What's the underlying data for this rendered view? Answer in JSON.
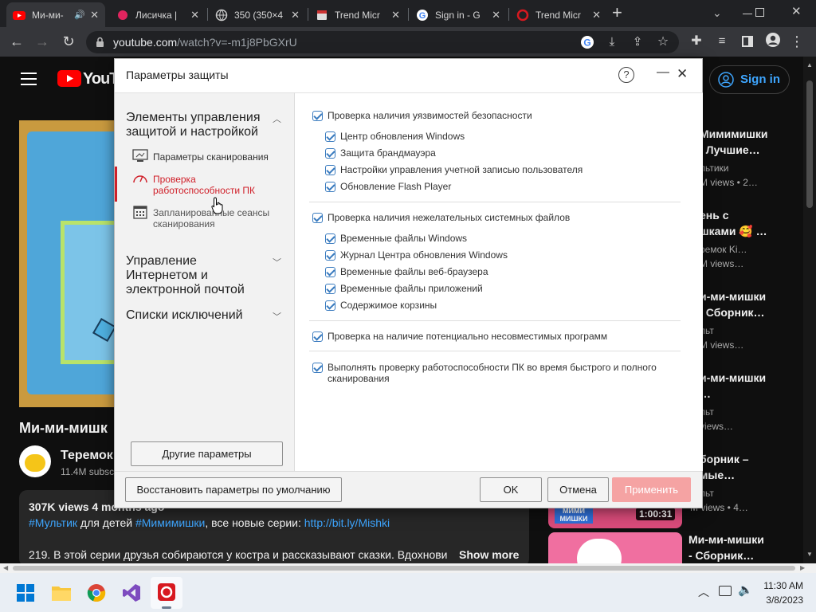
{
  "browser": {
    "tabs": [
      {
        "title": "Ми-ми-",
        "type": "youtube",
        "active": true
      },
      {
        "title": "Лисичка |",
        "type": "pink"
      },
      {
        "title": "350 (350×4",
        "type": "globe"
      },
      {
        "title": "Trend Micr",
        "type": "page"
      },
      {
        "title": "Sign in - G",
        "type": "google"
      },
      {
        "title": "Trend Micr",
        "type": "trend"
      }
    ],
    "new_tab": "+",
    "url_host": "youtube.com",
    "url_path": "/watch?v=-m1j8PbGXrU"
  },
  "youtube": {
    "logo": "YouTu",
    "sign_in": "Sign in",
    "video_title": "Ми-ми-мишк",
    "channel": "Теремок",
    "subs": "11.4M subsc",
    "desc_line1": "307K views  4 months ago",
    "desc_tags": "#Мультик",
    "desc_mid": " для детей ",
    "desc_tag2": "#Мимимишки",
    "desc_mid2": ", все новые серии: ",
    "desc_link": "http://bit.ly/Mishki",
    "desc_line3": "219. В этой серии друзья собираются у костра и рассказывают сказки. Вдохнови",
    "show_more": "Show more",
    "sidebar": [
      {
        "t1": "Мимимишки",
        "t2": "| Лучшие…",
        "ch": "льтики",
        "views": "M views • 2…"
      },
      {
        "t1": "ень с",
        "t2": "шками 🥰 …",
        "ch": "ремок Ki…",
        "views": "M views…"
      },
      {
        "t1": "и-ми-мишки",
        "t2": "| Сборник…",
        "ch": "льт",
        "views": "M views…"
      },
      {
        "t1": "и-ми-мишки",
        "t2": "…",
        "ch": "льт",
        "views": "views…"
      },
      {
        "t1": "борник –",
        "t2": "мые…",
        "ch": "льт",
        "views": "M views • 4…"
      },
      {
        "t1": "Ми-ми-мишки",
        "t2": "- Сборник…",
        "ch": "",
        "views": ""
      }
    ],
    "duration": "1:00:31",
    "thumb_label": "МИМИ МИШКИ"
  },
  "dialog": {
    "title": "Параметры защиты",
    "help": "?",
    "minimize": "—",
    "close": "✕",
    "nav": {
      "section1": "Элементы управления защитой и настройкой",
      "items": [
        "Параметры сканирования",
        "Проверка работоспособности ПК",
        "Запланированные сеансы сканирования"
      ],
      "section2": "Управление Интернетом и электронной почтой",
      "section3": "Списки исключений"
    },
    "groups": [
      {
        "label": "Проверка наличия уязвимостей безопасности",
        "items": [
          "Центр обновления Windows",
          "Защита брандмауэра",
          "Настройки управления учетной записью пользователя",
          "Обновление Flash Player"
        ]
      },
      {
        "label": "Проверка наличия нежелательных системных файлов",
        "items": [
          "Временные файлы Windows",
          "Журнал Центра обновления Windows",
          "Временные файлы веб-браузера",
          "Временные файлы приложений",
          "Содержимое корзины"
        ]
      },
      {
        "label": "Проверка на наличие потенциально несовместимых программ",
        "items": []
      },
      {
        "label": "Выполнять проверку работоспособности ПК во время быстрого и полного сканирования",
        "items": []
      }
    ],
    "other_params": "Другие параметры",
    "restore": "Восстановить параметры по умолчанию",
    "ok": "OK",
    "cancel": "Отмена",
    "apply": "Применить"
  },
  "taskbar": {
    "time": "11:30 AM",
    "date": "3/8/2023"
  }
}
